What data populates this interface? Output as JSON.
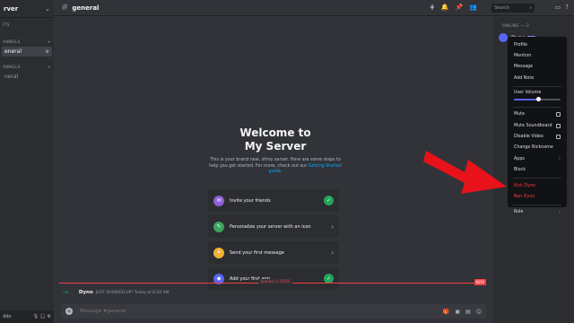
{
  "server": {
    "name": "rver",
    "chevron": "⌄"
  },
  "sidebar": {
    "top_item": "ITS",
    "categories": [
      {
        "label": "ANNELS",
        "add": "+"
      },
      {
        "label": "ANNELS",
        "add": "+"
      }
    ],
    "channels": [
      {
        "label": "eneral",
        "active": true
      },
      {
        "label": "neral",
        "active": false
      }
    ],
    "user": "ddo"
  },
  "topbar": {
    "channel": "general",
    "search_placeholder": "Search"
  },
  "welcome": {
    "title_line1": "Welcome to",
    "title_line2": "My Server",
    "subtitle": "This is your brand new, shiny server. Here are some steps to help you get started. For more, check out our",
    "link": "Getting Started guide",
    "subtitle_end": "."
  },
  "cards": [
    {
      "label": "Invite your friends",
      "state": "done",
      "icon_color": "#8e5fd8"
    },
    {
      "label": "Personalize your server with an icon",
      "state": "todo",
      "icon_color": "#3ba55d"
    },
    {
      "label": "Send your first message",
      "state": "todo",
      "icon_color": "#f0b232"
    },
    {
      "label": "Add your first app",
      "state": "done",
      "icon_color": "#5865f2"
    }
  ],
  "divider": {
    "date": "January 4, 2024",
    "badge": "NEW"
  },
  "system_message": {
    "user": "Dyno",
    "text": "JUST SHOWED UP! Today at 8:28 AM"
  },
  "composer": {
    "placeholder": "Message #general"
  },
  "members": {
    "online_label": "ONLINE — 2",
    "items": [
      {
        "name": "Dyno",
        "tag": "BOT"
      }
    ]
  },
  "context_menu": {
    "group1": [
      "Profile",
      "Mention",
      "Message",
      "Add Note"
    ],
    "volume_label": "User Volume",
    "volume_level": 0.52,
    "checks": [
      "Mute",
      "Mute Soundboard",
      "Disable Video"
    ],
    "group3": [
      "Change Nickname"
    ],
    "apps": "Apps",
    "block": "Block",
    "danger": [
      "Kick Dyno",
      "Ban Dyno"
    ],
    "role": "Role"
  },
  "colors": {
    "accent": "#5865f2",
    "danger": "#f23f43",
    "success": "#23a55a",
    "arrow": "#e8121a"
  }
}
